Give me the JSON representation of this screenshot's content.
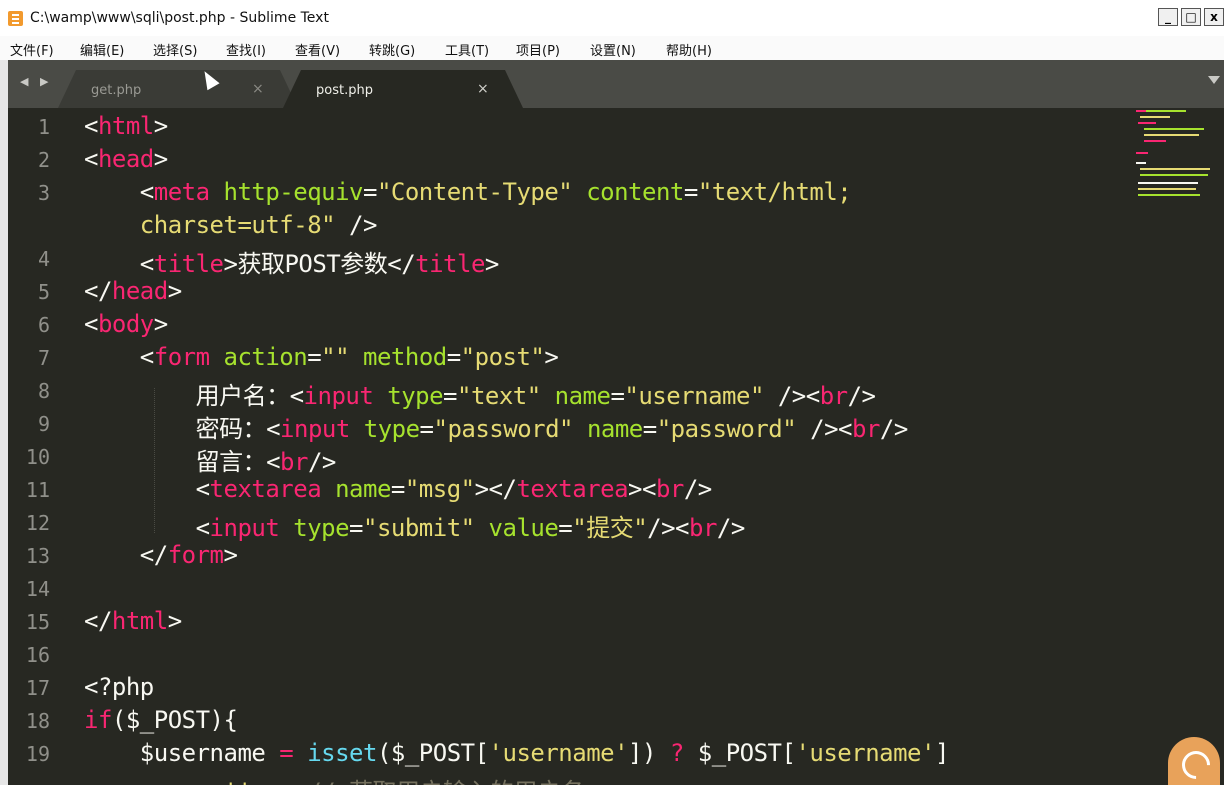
{
  "window": {
    "title": "C:\\wamp\\www\\sqli\\post.php - Sublime Text",
    "minimize": "_",
    "maximize": "□",
    "close": "x"
  },
  "menu": [
    "文件(F)",
    "编辑(E)",
    "选择(S)",
    "查找(I)",
    "查看(V)",
    "转跳(G)",
    "工具(T)",
    "项目(P)",
    "设置(N)",
    "帮助(H)"
  ],
  "tabs": [
    {
      "label": "get.php",
      "close": "×",
      "active": false
    },
    {
      "label": "post.php",
      "close": "×",
      "active": true
    }
  ],
  "nav": {
    "arrows": "◀ ▶"
  },
  "line_numbers": [
    "1",
    "2",
    "3",
    "",
    "4",
    "5",
    "6",
    "7",
    "8",
    "9",
    "10",
    "11",
    "12",
    "13",
    "14",
    "15",
    "16",
    "17",
    "18",
    "19",
    ""
  ],
  "code": [
    [
      [
        "p",
        "<"
      ],
      [
        "t",
        "html"
      ],
      [
        "p",
        ">"
      ]
    ],
    [
      [
        "p",
        "<"
      ],
      [
        "t",
        "head"
      ],
      [
        "p",
        ">"
      ]
    ],
    [
      [
        "p",
        "    <"
      ],
      [
        "t",
        "meta"
      ],
      [
        "p",
        " "
      ],
      [
        "a",
        "http-equiv"
      ],
      [
        "p",
        "="
      ],
      [
        "s",
        "\"Content-Type\""
      ],
      [
        "p",
        " "
      ],
      [
        "a",
        "content"
      ],
      [
        "p",
        "="
      ],
      [
        "s",
        "\"text/html;"
      ]
    ],
    [
      [
        "s",
        "    charset=utf-8\""
      ],
      [
        "p",
        " />"
      ]
    ],
    [
      [
        "p",
        "    <"
      ],
      [
        "t",
        "title"
      ],
      [
        "p",
        ">获取POST参数</"
      ],
      [
        "t",
        "title"
      ],
      [
        "p",
        ">"
      ]
    ],
    [
      [
        "p",
        "</"
      ],
      [
        "t",
        "head"
      ],
      [
        "p",
        ">"
      ]
    ],
    [
      [
        "p",
        "<"
      ],
      [
        "t",
        "body"
      ],
      [
        "p",
        ">"
      ]
    ],
    [
      [
        "p",
        "    <"
      ],
      [
        "t",
        "form"
      ],
      [
        "p",
        " "
      ],
      [
        "a",
        "action"
      ],
      [
        "p",
        "="
      ],
      [
        "s",
        "\"\""
      ],
      [
        "p",
        " "
      ],
      [
        "a",
        "method"
      ],
      [
        "p",
        "="
      ],
      [
        "s",
        "\"post\""
      ],
      [
        "p",
        ">"
      ]
    ],
    [
      [
        "p",
        "        用户名：<"
      ],
      [
        "t",
        "input"
      ],
      [
        "p",
        " "
      ],
      [
        "a",
        "type"
      ],
      [
        "p",
        "="
      ],
      [
        "s",
        "\"text\""
      ],
      [
        "p",
        " "
      ],
      [
        "a",
        "name"
      ],
      [
        "p",
        "="
      ],
      [
        "s",
        "\"username\""
      ],
      [
        "p",
        " /><"
      ],
      [
        "t",
        "br"
      ],
      [
        "p",
        "/>"
      ]
    ],
    [
      [
        "p",
        "        密码：<"
      ],
      [
        "t",
        "input"
      ],
      [
        "p",
        " "
      ],
      [
        "a",
        "type"
      ],
      [
        "p",
        "="
      ],
      [
        "s",
        "\"password\""
      ],
      [
        "p",
        " "
      ],
      [
        "a",
        "name"
      ],
      [
        "p",
        "="
      ],
      [
        "s",
        "\"password\""
      ],
      [
        "p",
        " /><"
      ],
      [
        "t",
        "br"
      ],
      [
        "p",
        "/>"
      ]
    ],
    [
      [
        "p",
        "        留言：<"
      ],
      [
        "t",
        "br"
      ],
      [
        "p",
        "/>"
      ]
    ],
    [
      [
        "p",
        "        <"
      ],
      [
        "t",
        "textarea"
      ],
      [
        "p",
        " "
      ],
      [
        "a",
        "name"
      ],
      [
        "p",
        "="
      ],
      [
        "s",
        "\"msg\""
      ],
      [
        "p",
        "></"
      ],
      [
        "t",
        "textarea"
      ],
      [
        "p",
        "><"
      ],
      [
        "t",
        "br"
      ],
      [
        "p",
        "/>"
      ]
    ],
    [
      [
        "p",
        "        <"
      ],
      [
        "t",
        "input"
      ],
      [
        "p",
        " "
      ],
      [
        "a",
        "type"
      ],
      [
        "p",
        "="
      ],
      [
        "s",
        "\"submit\""
      ],
      [
        "p",
        " "
      ],
      [
        "a",
        "value"
      ],
      [
        "p",
        "="
      ],
      [
        "s",
        "\"提交\""
      ],
      [
        "p",
        "/><"
      ],
      [
        "t",
        "br"
      ],
      [
        "p",
        "/>"
      ]
    ],
    [
      [
        "p",
        "    </"
      ],
      [
        "t",
        "form"
      ],
      [
        "p",
        ">"
      ]
    ],
    [
      [
        "p",
        ""
      ]
    ],
    [
      [
        "p",
        "</"
      ],
      [
        "t",
        "html"
      ],
      [
        "p",
        ">"
      ]
    ],
    [
      [
        "p",
        ""
      ]
    ],
    [
      [
        "p",
        "<?php"
      ]
    ],
    [
      [
        "k",
        "if"
      ],
      [
        "p",
        "($_POST){"
      ]
    ],
    [
      [
        "p",
        "    $username "
      ],
      [
        "k",
        "="
      ],
      [
        "p",
        " "
      ],
      [
        "f",
        "isset"
      ],
      [
        "p",
        "($_POST["
      ],
      [
        "s",
        "'username'"
      ],
      [
        "p",
        "]) "
      ],
      [
        "k",
        "?"
      ],
      [
        "p",
        " $_POST["
      ],
      [
        "s",
        "'username'"
      ],
      [
        "p",
        "]"
      ]
    ],
    [
      [
        "p",
        "        : "
      ],
      [
        "s",
        "''"
      ],
      [
        "p",
        ";   "
      ],
      [
        "c",
        "// 获取用户输入的用户名"
      ]
    ]
  ],
  "colors": {
    "tag": "#f92672",
    "attr": "#a6e22e",
    "string": "#e6db74",
    "function": "#66d9ef",
    "comment": "#75715e",
    "background": "#272822"
  }
}
